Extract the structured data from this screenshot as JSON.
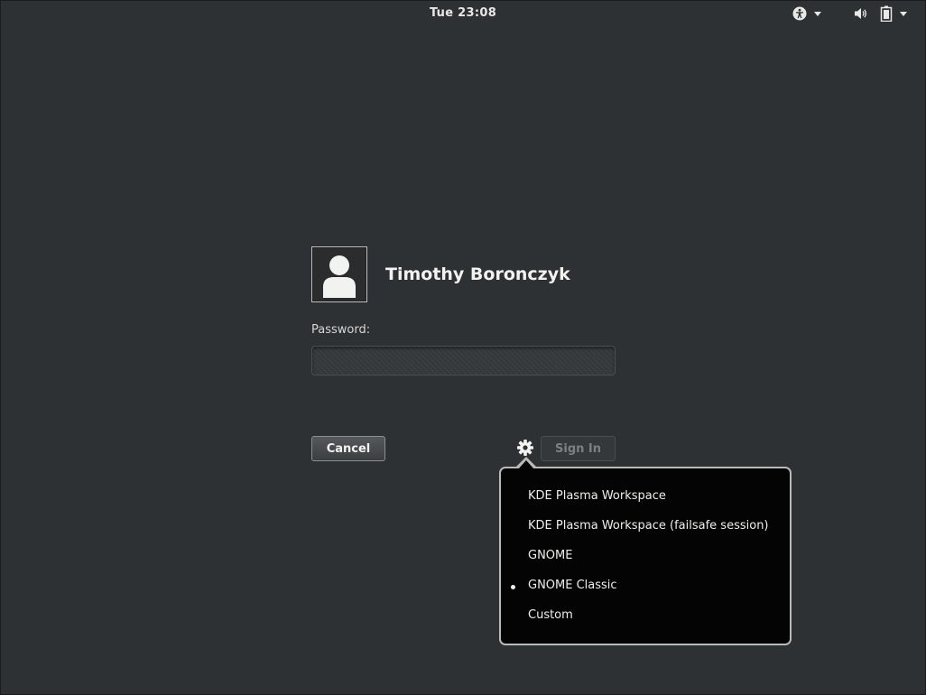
{
  "topbar": {
    "clock": "Tue 23:08",
    "icons": [
      "accessibility-icon",
      "volume-icon",
      "battery-icon"
    ]
  },
  "user": {
    "name": "Timothy Boronczyk",
    "avatar_icon": "user-avatar-icon"
  },
  "login": {
    "password_label": "Password:",
    "password_value": ""
  },
  "buttons": {
    "cancel": "Cancel",
    "sign_in": "Sign In"
  },
  "session_menu": {
    "icon": "gear-icon",
    "selected": "GNOME Classic",
    "items": [
      {
        "label": "KDE Plasma Workspace"
      },
      {
        "label": "KDE Plasma Workspace (failsafe session)"
      },
      {
        "label": "GNOME"
      },
      {
        "label": "GNOME Classic"
      },
      {
        "label": "Custom"
      }
    ]
  },
  "colors": {
    "background": "#2e3133",
    "menu_background": "#040404",
    "menu_border": "#b9bab7",
    "text": "#eeeeec"
  }
}
